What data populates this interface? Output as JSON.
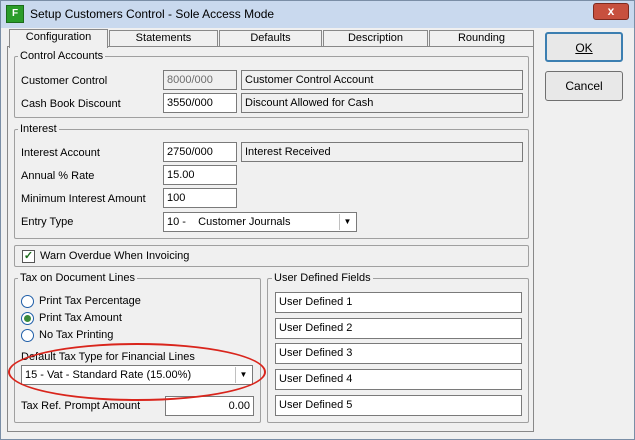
{
  "window": {
    "title": "Setup Customers Control - Sole Access Mode",
    "app_icon_glyph": "F",
    "close_glyph": "x"
  },
  "tabs": [
    {
      "label": "Configuration",
      "active": true
    },
    {
      "label": "Statements"
    },
    {
      "label": "Defaults"
    },
    {
      "label": "Description"
    },
    {
      "label": "Rounding"
    }
  ],
  "buttons": {
    "ok": "OK",
    "cancel": "Cancel"
  },
  "control_accounts": {
    "title": "Control Accounts",
    "customer_control": {
      "label": "Customer Control",
      "code": "8000/000",
      "desc": "Customer Control Account"
    },
    "cash_book_discount": {
      "label": "Cash Book Discount",
      "code": "3550/000",
      "desc": "Discount Allowed for Cash"
    }
  },
  "interest": {
    "title": "Interest",
    "account": {
      "label": "Interest Account",
      "code": "2750/000",
      "desc": "Interest Received"
    },
    "annual_rate": {
      "label": "Annual % Rate",
      "value": "15.00"
    },
    "min_amount": {
      "label": "Minimum Interest Amount",
      "value": "100"
    },
    "entry_type": {
      "label": "Entry Type",
      "value": "10 -    Customer Journals"
    }
  },
  "warn_overdue": {
    "label": "Warn Overdue When Invoicing",
    "checked": true
  },
  "tax": {
    "title": "Tax on Document Lines",
    "options": [
      "Print Tax Percentage",
      "Print Tax Amount",
      "No Tax Printing"
    ],
    "selected": 1,
    "default_type_label": "Default Tax Type for Financial Lines",
    "default_type_value": "15 - Vat - Standard Rate (15.00%)",
    "prompt_label": "Tax Ref. Prompt Amount",
    "prompt_value": "0.00"
  },
  "user_defined": {
    "title": "User Defined Fields",
    "fields": [
      "User Defined 1",
      "User Defined 2",
      "User Defined 3",
      "User Defined 4",
      "User Defined 5"
    ]
  },
  "colors": {
    "highlight": "#d9251c",
    "title_bar": "#c9d9ee",
    "close": "#c7503e"
  }
}
